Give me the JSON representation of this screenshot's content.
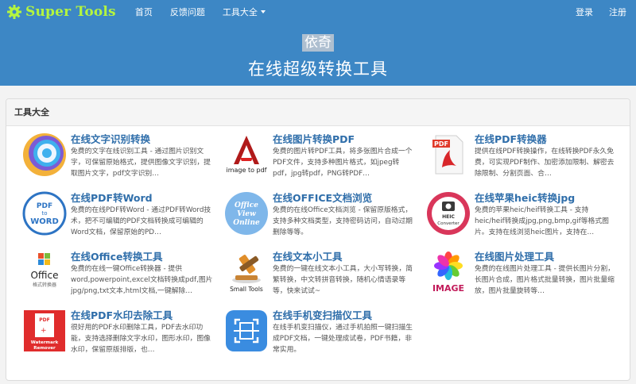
{
  "brand": {
    "name": "Super Tools"
  },
  "nav": {
    "items": [
      {
        "label": "首页"
      },
      {
        "label": "反馈问题"
      },
      {
        "label": "工具大全"
      }
    ],
    "login": "登录",
    "register": "注册"
  },
  "hero": {
    "subtitle": "依奇",
    "title": "在线超级转换工具"
  },
  "panel": {
    "heading": "工具大全"
  },
  "tools": [
    {
      "title": "在线文字识别转换",
      "desc": "免费的文字在线识别工具 - 通过图片识别文字，可保留原始格式，提供图像文字识别，提取图片文字，pdf文字识别…",
      "icon": "ocr-icon"
    },
    {
      "title": "在线图片转换PDF",
      "desc": "免费的图片转PDF工具，将多张图片合成一个PDF文件，支持多种图片格式，如jpeg转pdf，jpg转pdf，PNG转PDF…",
      "icon": "image-to-pdf-icon",
      "icon_text": "image to pdf"
    },
    {
      "title": "在线PDF转换器",
      "desc": "提供在线PDF转换操作，在线转换PDF永久免费，可实现PDF制作、加密添加限制、解密去除限制、分割页面、合…",
      "icon": "pdf-file-icon",
      "icon_text": "PDF"
    },
    {
      "title": "在线PDF转Word",
      "desc": "免费的在线PDF转Word - 通过PDF转Word技术，把不可编辑的PDF文档转换成可编辑的Word文档，保留原始的PD…",
      "icon": "pdf-to-word-icon",
      "icon_text": [
        "PDF",
        "to",
        "WORD"
      ]
    },
    {
      "title": "在线OFFICE文档浏览",
      "desc": "免费的在线Office文档浏览 - 保留原版格式，支持多种文档类型，支持密码访问，自动过期删除等等。",
      "icon": "office-view-online-icon",
      "icon_text": [
        "Office",
        "View",
        "Online"
      ]
    },
    {
      "title": "在线苹果heic转换jpg",
      "desc": "免费的苹果heic/heif转换工具 - 支持heic/heif转换成jpg,png,bmp,gif等格式图片。支持在线浏览heic图片，支持在…",
      "icon": "heic-converter-icon",
      "icon_text": [
        "HEIC",
        "Converter"
      ]
    },
    {
      "title": "在线Office转换工具",
      "desc": "免费的在线一键Office转换器 - 提供word,powerpoint,excel文档转换成pdf,图片jpg/png,txt文本,html文档,一键解除…",
      "icon": "office-convert-icon",
      "icon_text": [
        "Office",
        "格式转换器"
      ]
    },
    {
      "title": "在线文本小工具",
      "desc": "免费的一键在线文本小工具，大小写转换，简繁转换，中文转拼音转换，随机心情语录等等，快来试试~",
      "icon": "small-tools-icon",
      "icon_text": "Small Tools"
    },
    {
      "title": "在线图片处理工具",
      "desc": "免费的在线图片处理工具 - 提供长图片分割，长图片合成，图片格式批量转换，图片批量缩放，图片批量旋转等…",
      "icon": "image-process-icon",
      "icon_text": "IMAGE"
    },
    {
      "title": "在线PDF水印去除工具",
      "desc": "很好用的PDF水印删除工具，PDF去水印功能，支持选择删除文字水印，图形水印，图像水印，保留原版排版，也…",
      "icon": "watermark-remover-icon",
      "icon_text": [
        "PDF",
        "Watermark",
        "Remover"
      ]
    },
    {
      "title": "在线手机变扫描仪工具",
      "desc": "在线手机变扫描仪，通过手机拍照一键扫描生成PDF文档，一键处理成试卷，PDF书籍，非常实用。",
      "icon": "scanner-icon"
    }
  ],
  "colors": {
    "nav_bg": "#3d87c5",
    "brand": "#b4f53f",
    "link": "#2f6eaa"
  }
}
